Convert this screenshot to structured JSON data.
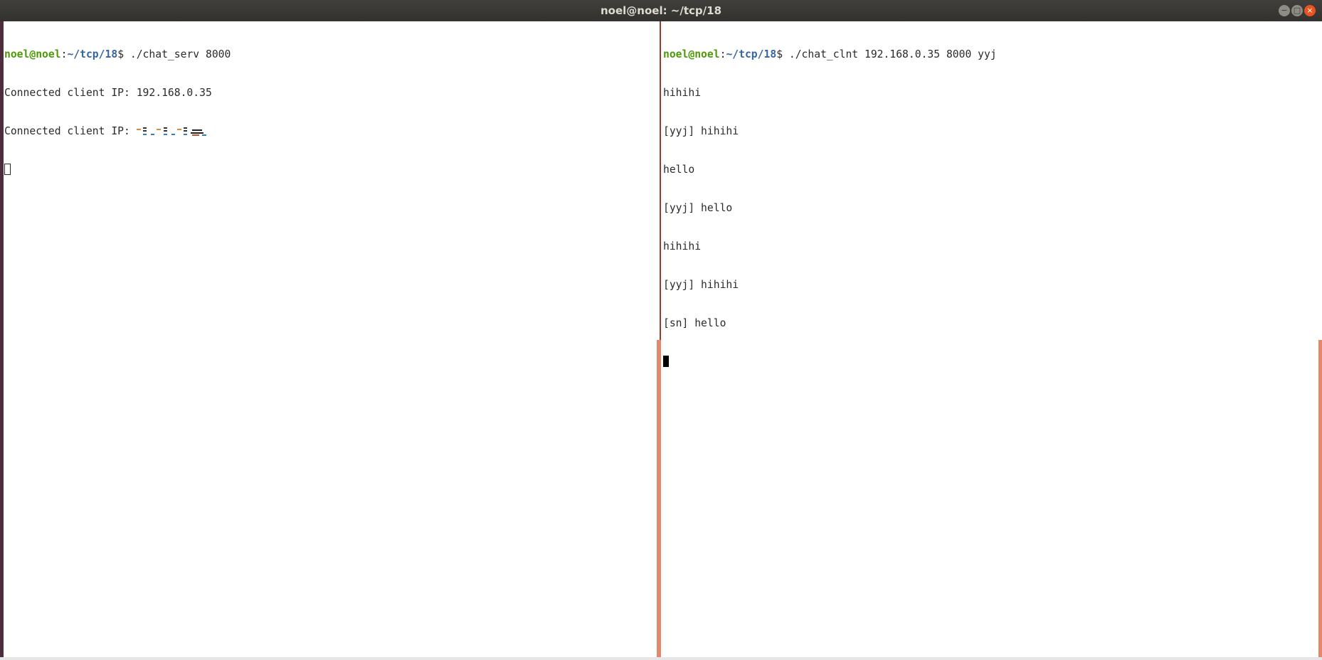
{
  "window": {
    "title": "noel@noel: ~/tcp/18",
    "buttons": {
      "minimize": "−",
      "maximize": "□",
      "close": "×"
    }
  },
  "colors": {
    "prompt_user": "#4e9a06",
    "prompt_path": "#3465a4",
    "text": "#2b2b2b",
    "accent": "#e95420"
  },
  "left_pane": {
    "prompt_user": "noel@noel",
    "prompt_sep": ":",
    "prompt_path": "~/tcp/18",
    "prompt_end": "$",
    "command": " ./chat_serv 8000",
    "lines": [
      "Connected client IP: 192.168.0.35",
      "Connected client IP: "
    ]
  },
  "right_pane": {
    "prompt_user": "noel@noel",
    "prompt_sep": ":",
    "prompt_path": "~/tcp/18",
    "prompt_end": "$",
    "command": " ./chat_clnt 192.168.0.35 8000 yyj",
    "lines": [
      "hihihi",
      "[yyj] hihihi",
      "hello",
      "[yyj] hello",
      "hihihi",
      "[yyj] hihihi",
      "[sn] hello"
    ]
  }
}
